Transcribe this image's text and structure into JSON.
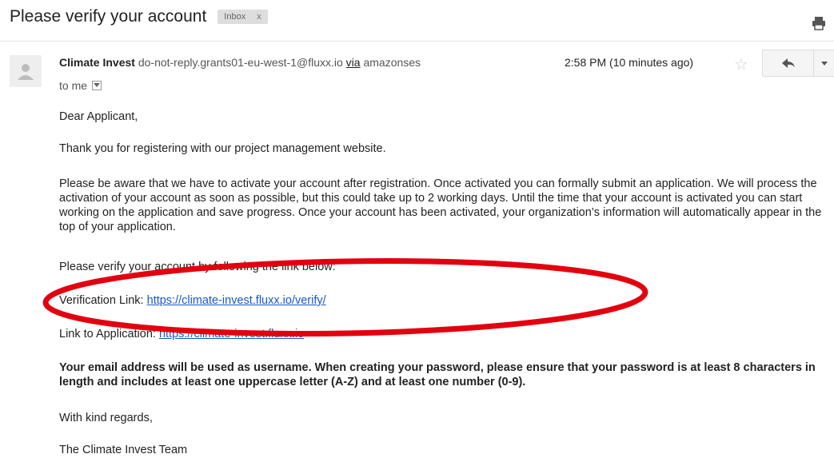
{
  "subject": "Please verify your account",
  "label": {
    "text": "Inbox",
    "close": "x"
  },
  "sender": {
    "name": "Climate Invest",
    "email": "do-not-reply.grants01-eu-west-1@fluxx.io",
    "via_label": "via",
    "via_domain": "amazonses"
  },
  "recipient": "to me",
  "timestamp": "2:58 PM (10 minutes ago)",
  "icons": {
    "print": "print-icon",
    "avatar": "person-icon",
    "star": "star-icon",
    "reply": "reply-icon",
    "more": "chevron-down-icon",
    "details": "chevron-down-icon"
  },
  "body": {
    "greeting": "Dear Applicant,",
    "thanks": "Thank you for registering with our project management website.",
    "aware": "Please be aware that we have to activate your account after registration. Once activated you can formally submit an application. We will process the activation of your account as soon as possible, but this could take up to 2 working days. Until the time that your account is activated you can start working on the application and save progress. Once your account has been activated, your organization’s information will automatically appear in the top of your application.",
    "verify_instructions": "Please verify your account by following the link below:",
    "verification_label": "Verification Link:",
    "verification_url": "https://climate-invest.fluxx.io/verify/",
    "application_label": "Link to Application:",
    "application_url": "https://climate-invest.fluxx.io",
    "password_note": "Your email address will be used as username. When creating your password, please ensure that your password is at least 8 characters in length and includes at least one uppercase letter (A-Z) and at least one number (0-9).",
    "closing": "With kind regards,",
    "signature": "The Climate Invest Team"
  },
  "colors": {
    "annotation": "#e3000f",
    "link": "#1a57c9"
  }
}
